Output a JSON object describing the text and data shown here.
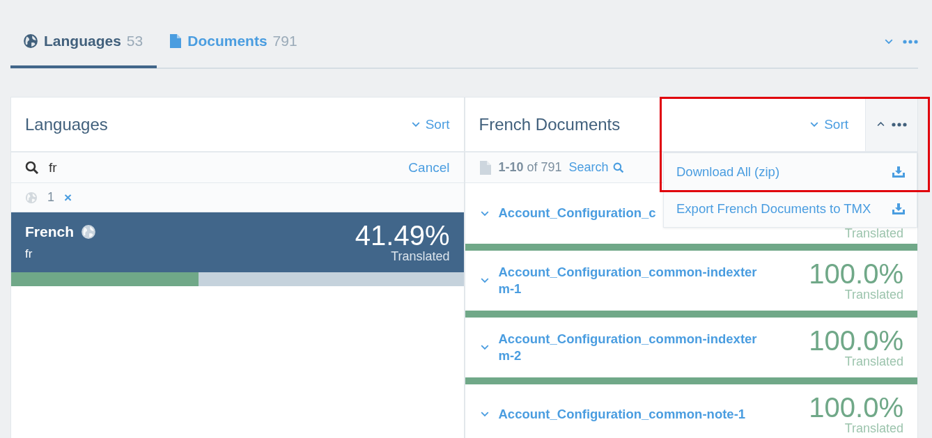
{
  "tabs": [
    {
      "kind": "globe",
      "label": "Languages",
      "count": "53",
      "selected": true
    },
    {
      "kind": "document",
      "label": "Documents",
      "count": "791",
      "selected": false
    }
  ],
  "languages_panel": {
    "title": "Languages",
    "sort": "Sort",
    "search": {
      "value": "fr",
      "cancel": "Cancel"
    },
    "filter": {
      "count": "1",
      "clear": "×"
    },
    "items": [
      {
        "name": "French",
        "code": "fr",
        "percent": "41.49%",
        "caption": "Translated",
        "level": 0.4149,
        "selected": true
      }
    ]
  },
  "documents_panel": {
    "title": "French Documents",
    "sort": "Sort",
    "menu_open": true,
    "range": "1-10",
    "of": "of 791",
    "search": "Search",
    "menu": [
      "Download All (zip)",
      "Export French Documents to TMX"
    ],
    "items": [
      {
        "name": "Account_Configuration_c",
        "caption": "Translated",
        "level": 1
      },
      {
        "name": "Account_Configuration_common-indexterm-1",
        "percent": "100.0%",
        "caption": "Translated",
        "level": 1
      },
      {
        "name": "Account_Configuration_common-indexterm-2",
        "percent": "100.0%",
        "caption": "Translated",
        "level": 1
      },
      {
        "name": "Account_Configuration_common-note-1",
        "percent": "100.0%",
        "caption": "Translated"
      }
    ]
  }
}
